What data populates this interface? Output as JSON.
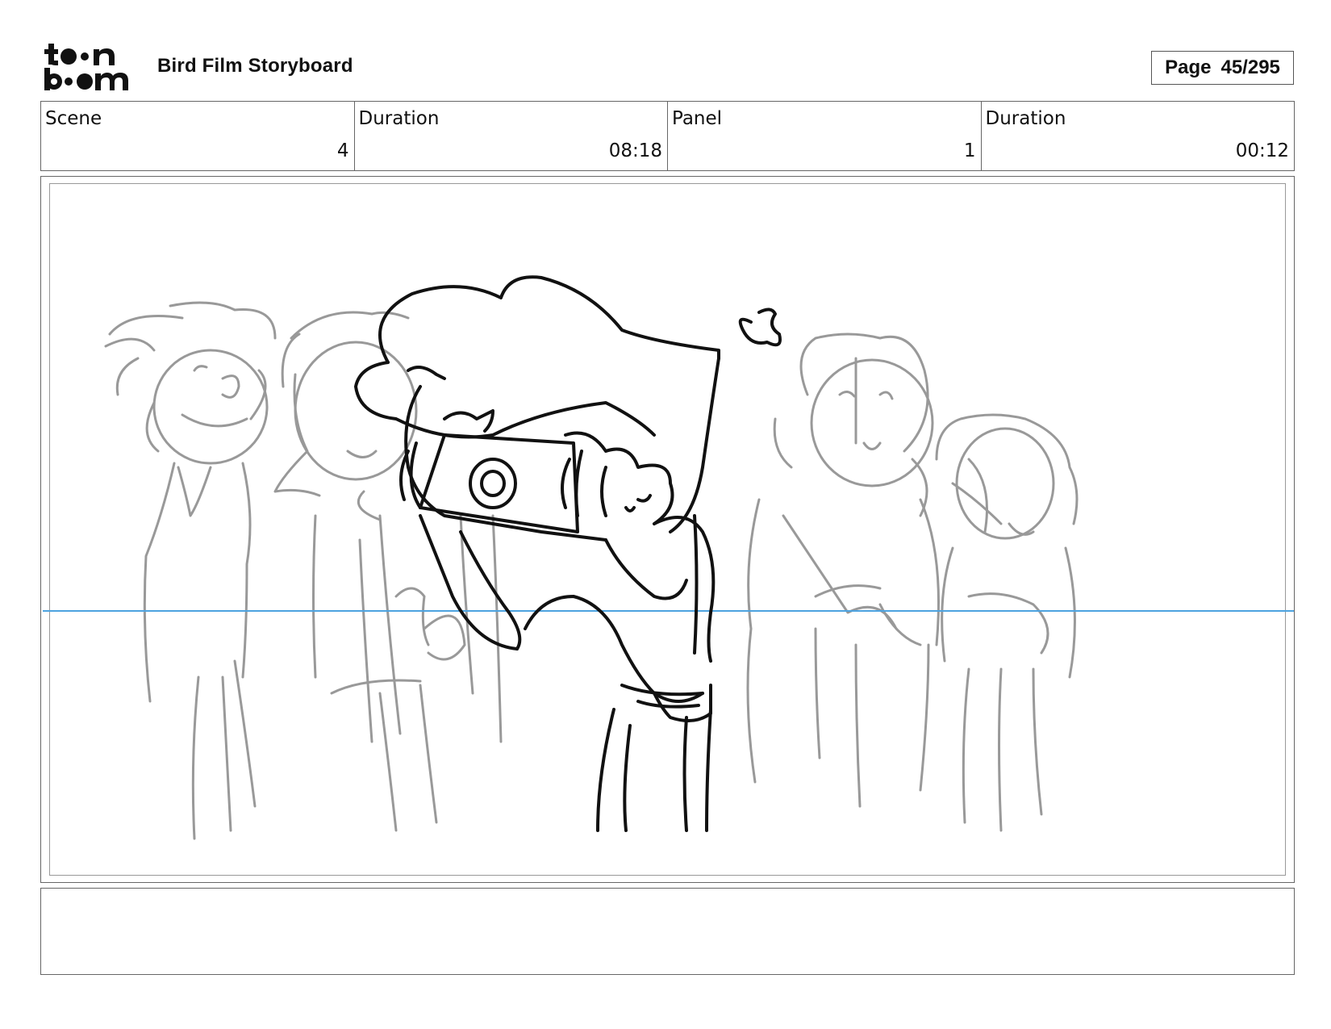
{
  "header": {
    "logo_text": "toonboom",
    "title": "Bird Film Storyboard",
    "page_label": "Page",
    "page_value": "45/295"
  },
  "info": {
    "scene_label": "Scene",
    "scene_value": "4",
    "scene_duration_label": "Duration",
    "scene_duration_value": "08:18",
    "panel_label": "Panel",
    "panel_value": "1",
    "panel_duration_label": "Duration",
    "panel_duration_value": "00:12"
  },
  "colors": {
    "horizon_line": "#4da3e0",
    "foreground_ink": "#111111",
    "background_ink": "#999999"
  },
  "notes": {
    "text": ""
  }
}
